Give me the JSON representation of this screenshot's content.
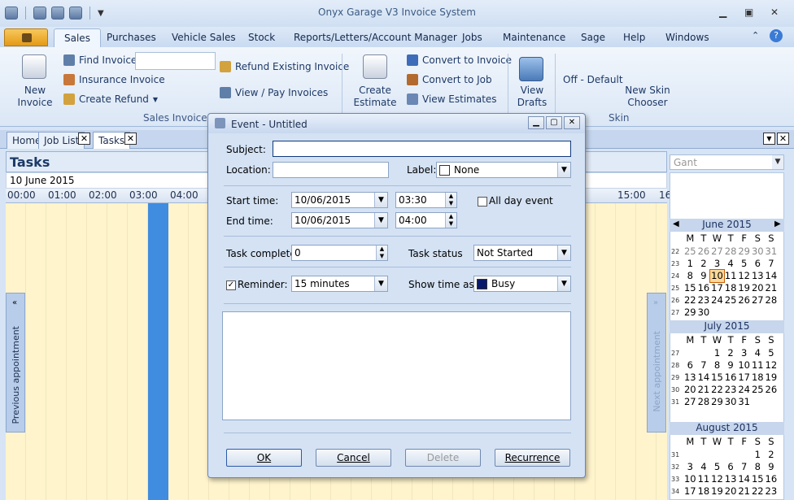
{
  "app": {
    "title": "Onyx Garage V3 Invoice System"
  },
  "menu": [
    "Sales",
    "Purchases",
    "Vehicle Sales",
    "Stock",
    "Reports/Letters/Account Manager",
    "Jobs",
    "Maintenance",
    "Sage",
    "Help",
    "Windows"
  ],
  "ribbon": {
    "new_invoice": "New\nInvoice",
    "find_invoice": "Find Invoice",
    "insurance_invoice": "Insurance Invoice",
    "create_refund": "Create Refund",
    "refund_existing": "Refund Existing Invoice",
    "view_pay": "View / Pay Invoices",
    "sales_invoices_group": "Sales Invoices",
    "create_estimate": "Create\nEstimate",
    "convert_invoice": "Convert to Invoice",
    "convert_job": "Convert to Job",
    "view_estimates": "View Estimates",
    "view_drafts": "View\nDrafts",
    "off_default": "Off - Default",
    "new_skin": "New Skin\nChooser",
    "skin_group": "Skin"
  },
  "doc_tabs": [
    "Home",
    "Job List",
    "Tasks"
  ],
  "tasks": {
    "title": "Tasks",
    "date": "10 June 2015",
    "view_select": "Gant",
    "times": [
      "00:00",
      "01:00",
      "02:00",
      "03:00",
      "04:00",
      "15:00",
      "16"
    ],
    "prev_appt": "Previous appointment",
    "next_appt": "Next appointment"
  },
  "calendar": {
    "months": [
      {
        "name": "June 2015",
        "weeks": [
          {
            "wk": "22",
            "days": [
              "25",
              "26",
              "27",
              "28",
              "29",
              "30",
              "31"
            ],
            "gray": [
              0,
              1,
              2,
              3,
              4,
              5,
              6
            ]
          },
          {
            "wk": "23",
            "days": [
              "1",
              "2",
              "3",
              "4",
              "5",
              "6",
              "7"
            ]
          },
          {
            "wk": "24",
            "days": [
              "8",
              "9",
              "10",
              "11",
              "12",
              "13",
              "14"
            ],
            "today": 2
          },
          {
            "wk": "25",
            "days": [
              "15",
              "16",
              "17",
              "18",
              "19",
              "20",
              "21"
            ]
          },
          {
            "wk": "26",
            "days": [
              "22",
              "23",
              "24",
              "25",
              "26",
              "27",
              "28"
            ]
          },
          {
            "wk": "27",
            "days": [
              "29",
              "30",
              "",
              "",
              "",
              "",
              ""
            ]
          }
        ]
      },
      {
        "name": "July 2015",
        "weeks": [
          {
            "wk": "27",
            "days": [
              "",
              "",
              "1",
              "2",
              "3",
              "4",
              "5"
            ]
          },
          {
            "wk": "28",
            "days": [
              "6",
              "7",
              "8",
              "9",
              "10",
              "11",
              "12"
            ]
          },
          {
            "wk": "29",
            "days": [
              "13",
              "14",
              "15",
              "16",
              "17",
              "18",
              "19"
            ]
          },
          {
            "wk": "30",
            "days": [
              "20",
              "21",
              "22",
              "23",
              "24",
              "25",
              "26"
            ]
          },
          {
            "wk": "31",
            "days": [
              "27",
              "28",
              "29",
              "30",
              "31",
              "",
              ""
            ]
          }
        ]
      },
      {
        "name": "August 2015",
        "weeks": [
          {
            "wk": "31",
            "days": [
              "",
              "",
              "",
              "",
              "",
              "1",
              "2"
            ]
          },
          {
            "wk": "32",
            "days": [
              "3",
              "4",
              "5",
              "6",
              "7",
              "8",
              "9"
            ]
          },
          {
            "wk": "33",
            "days": [
              "10",
              "11",
              "12",
              "13",
              "14",
              "15",
              "16"
            ]
          },
          {
            "wk": "34",
            "days": [
              "17",
              "18",
              "19",
              "20",
              "21",
              "22",
              "23"
            ]
          }
        ]
      }
    ],
    "weekdays": [
      "M",
      "T",
      "W",
      "T",
      "F",
      "S",
      "S"
    ]
  },
  "dialog": {
    "title": "Event - Untitled",
    "subject_label": "Subject:",
    "subject_value": "",
    "location_label": "Location:",
    "location_value": "",
    "label_label": "Label:",
    "label_value": "None",
    "start_label": "Start time:",
    "start_date": "10/06/2015",
    "start_time": "03:30",
    "end_label": "End time:",
    "end_date": "10/06/2015",
    "end_time": "04:00",
    "all_day_label": "All day event",
    "complete_label": "Task complete:",
    "complete_value": "0",
    "status_label": "Task status",
    "status_value": "Not Started",
    "reminder_label": "Reminder:",
    "reminder_value": "15 minutes",
    "show_as_label": "Show time as:",
    "show_as_value": "Busy",
    "show_as_color": "#0a1a6b",
    "ok": "OK",
    "cancel": "Cancel",
    "delete": "Delete",
    "recurrence": "Recurrence"
  }
}
